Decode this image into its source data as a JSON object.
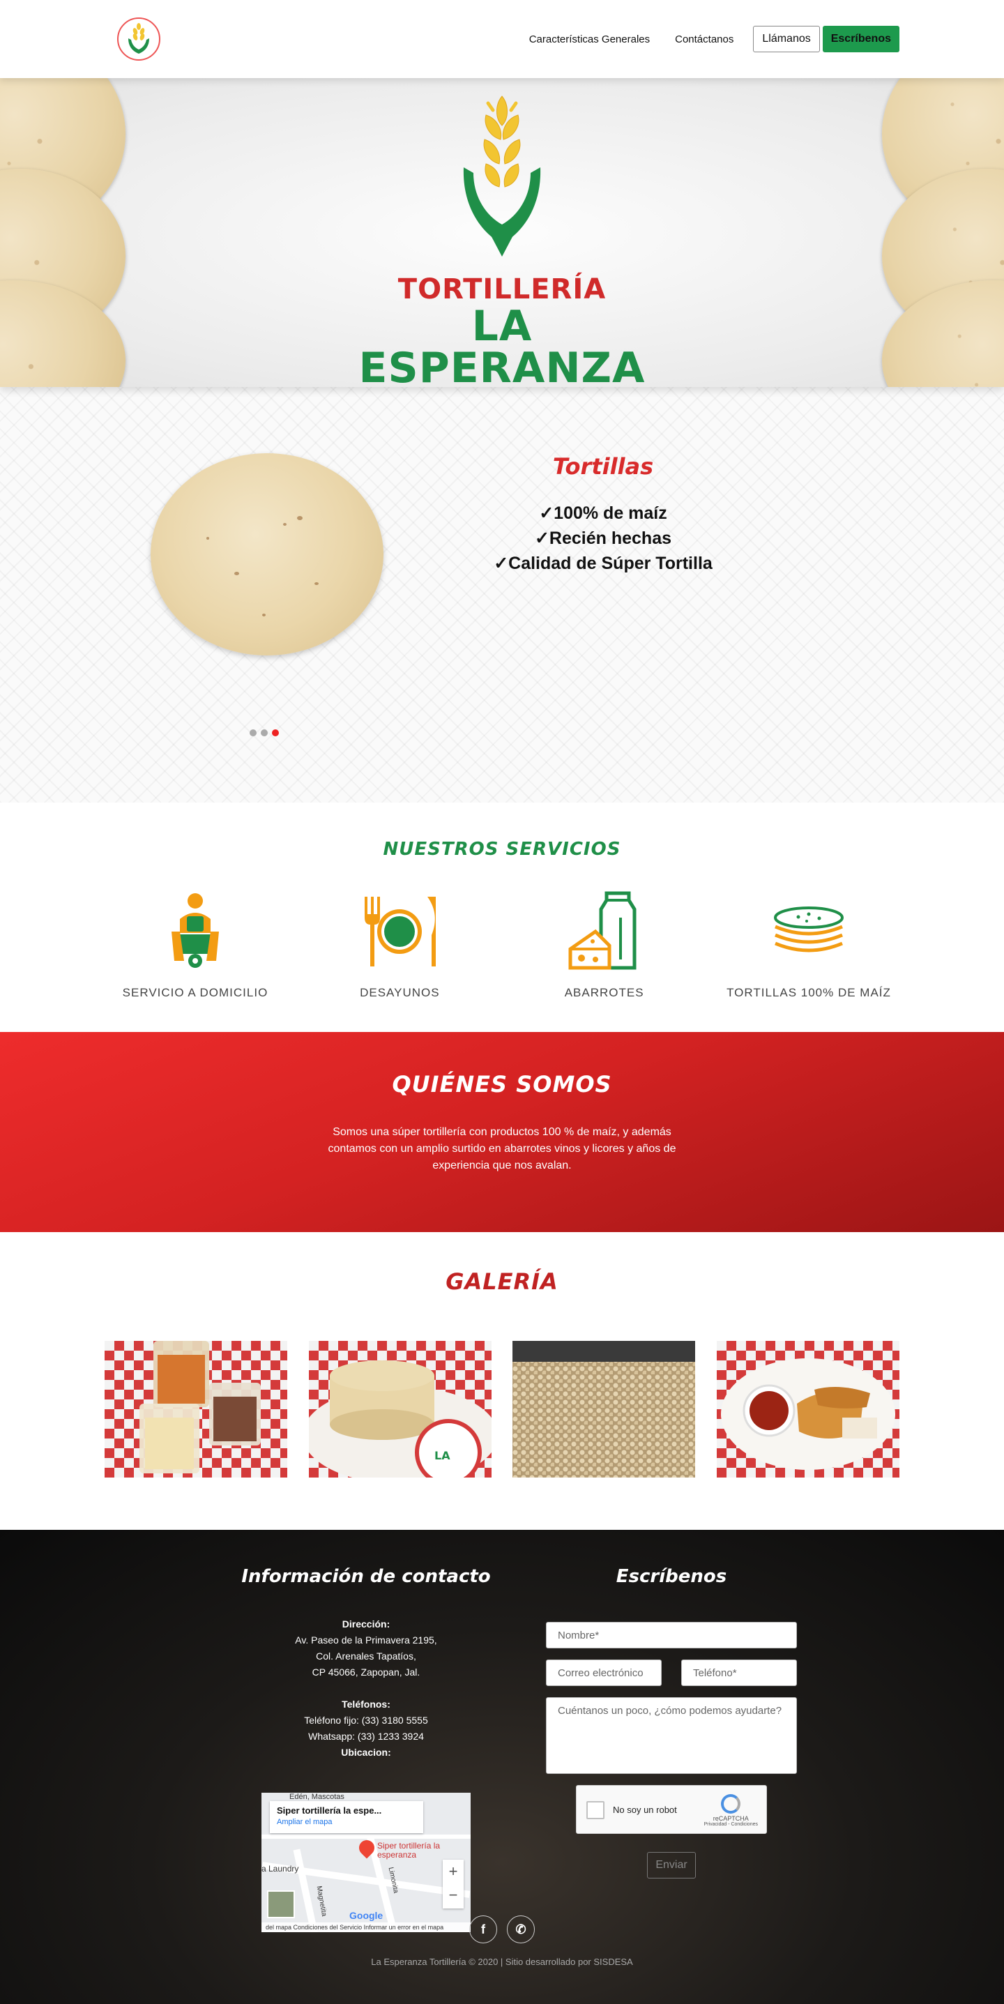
{
  "nav": {
    "logo_icon": "wheat-hands-logo",
    "links": [
      {
        "label": "Características Generales"
      },
      {
        "label": "Contáctanos"
      }
    ],
    "call_label": "Llámanos",
    "write_label": "Escríbenos"
  },
  "hero": {
    "brand_line1": "TORTILLERÍA",
    "brand_line2": "LA ESPERANZA",
    "colors": {
      "red": "#d02a2a",
      "green": "#1f8f48",
      "yellow": "#f2c531"
    }
  },
  "slider": {
    "title": "Tortillas",
    "lines": [
      "✓100% de maíz",
      "✓Recién hechas",
      "✓Calidad de Súper Tortilla"
    ],
    "active_slide": 3,
    "slide_count": 3
  },
  "services": {
    "title": "NUESTROS SERVICIOS",
    "items": [
      {
        "label": "SERVICIO A DOMICILIO",
        "icon": "delivery-scooter-icon"
      },
      {
        "label": "DESAYUNOS",
        "icon": "plate-cutlery-icon"
      },
      {
        "label": "ABARROTES",
        "icon": "groceries-icon"
      },
      {
        "label": "TORTILLAS 100% DE MAÍZ",
        "icon": "tortilla-stack-icon"
      }
    ]
  },
  "about": {
    "title": "QUIÉNES SOMOS",
    "text": "Somos una súper tortillería con productos 100 % de maíz, y además contamos con un amplio surtido en abarrotes vinos y licores y años de experiencia que nos avalan."
  },
  "gallery": {
    "title": "GALERÍA",
    "images": [
      "salsa-containers-photo",
      "tortilla-stack-photo",
      "corn-kernels-photo",
      "quesadillas-plate-photo"
    ]
  },
  "footer": {
    "contact_title": "Información de contacto",
    "address_label": "Dirección:",
    "address_lines": [
      "Av. Paseo de la Primavera 2195,",
      "Col. Arenales Tapatíos,",
      "CP 45066, Zapopan, Jal."
    ],
    "phones_label": "Teléfonos:",
    "phone_fixed": "Teléfono fijo: (33) 3180 5555",
    "whatsapp": "Whatsapp: (33) 1233 3924",
    "location_label": "Ubicacion:",
    "map": {
      "place": "Siper tortillería la espe...",
      "enlarge": "Ampliar el mapa",
      "pin_label": "Siper tortillería la esperanza",
      "top_label": "Edén, Mascotas",
      "street1": "Magnetita",
      "street2": "Limonita",
      "laundry": "a Laundry",
      "google": "Google",
      "bottom_links": "del mapa    Condiciones del Servicio    Informar un error en el mapa"
    },
    "form_title": "Escríbenos",
    "form": {
      "name_placeholder": "Nombre*",
      "email_placeholder": "Correo electrónico",
      "phone_placeholder": "Teléfono*",
      "message_placeholder": "Cuéntanos un poco, ¿cómo podemos ayudarte?",
      "captcha_label": "No soy un robot",
      "captcha_brand": "reCAPTCHA",
      "captcha_links": "Privacidad - Condiciones",
      "submit_label": "Enviar"
    },
    "social": [
      {
        "icon": "facebook-icon",
        "glyph": "f"
      },
      {
        "icon": "whatsapp-icon",
        "glyph": "✆"
      }
    ],
    "copyright": "La Esperanza Tortillería © 2020 | Sitio desarrollado por SISDESA"
  }
}
